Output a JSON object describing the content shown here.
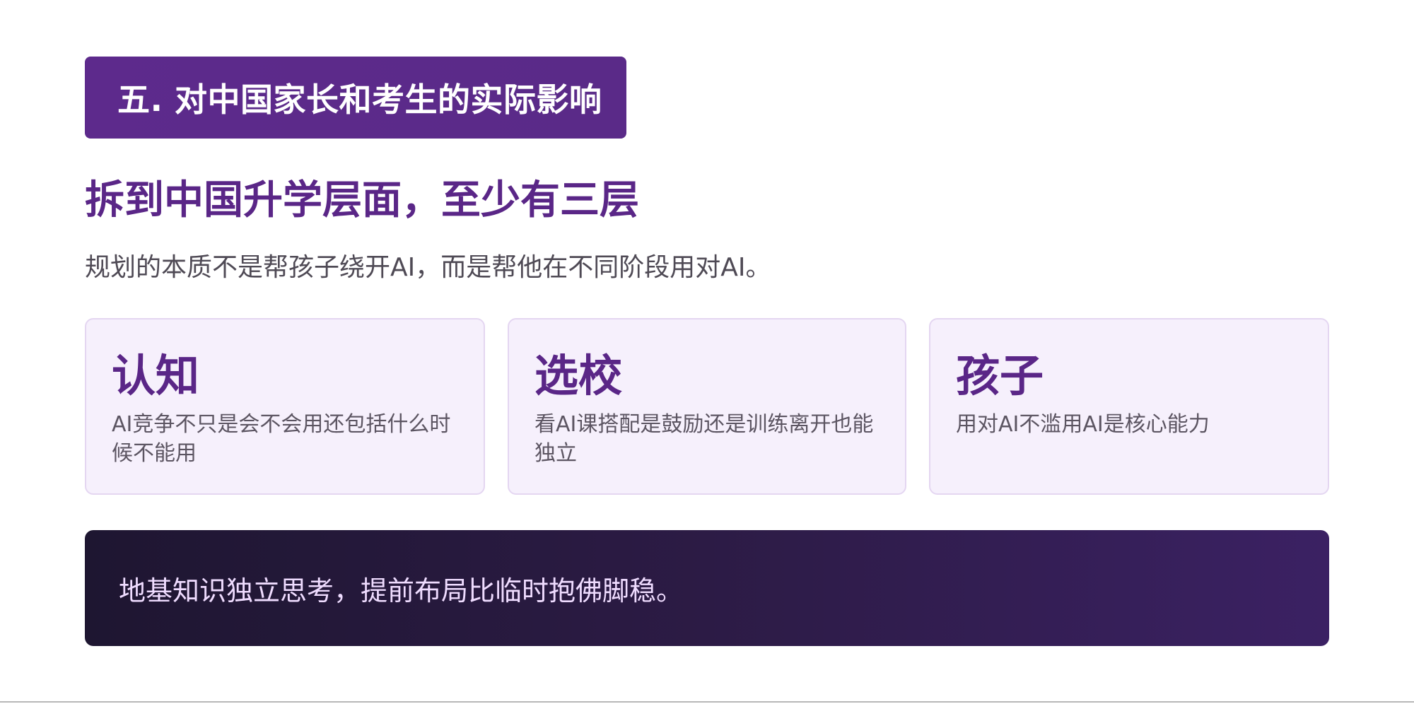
{
  "section": {
    "badge_label": "五. 对中国家长和考生的实际影响"
  },
  "headline": "拆到中国升学层面，至少有三层",
  "subtitle": "规划的本质不是帮孩子绕开AI，而是帮他在不同阶段用对AI。",
  "cards": [
    {
      "title": "认知",
      "description": "AI竞争不只是会不会用还包括什么时候不能用"
    },
    {
      "title": "选校",
      "description": "看AI课搭配是鼓励还是训练离开也能独立"
    },
    {
      "title": "孩子",
      "description": "用对AI不滥用AI是核心能力"
    }
  ],
  "callout": "地基知识独立思考，提前布局比临时抱佛脚稳。",
  "colors": {
    "accent": "#5a2687",
    "badge_background": "#5d2a8c",
    "card_background": "#f6f0fc",
    "card_border": "#e4d6f1",
    "callout_background_start": "#1e1631",
    "callout_background_end": "#3b2163",
    "callout_text": "#efdcff"
  }
}
